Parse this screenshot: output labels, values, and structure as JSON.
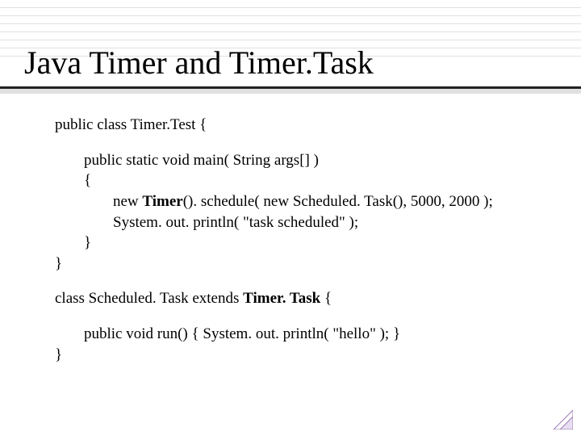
{
  "title": "Java Timer and Timer.Task",
  "code": {
    "class_decl": "public class Timer.Test {",
    "main_sig": "public static void main( String args[] )",
    "open_brace": "{",
    "line_new_prefix": "new ",
    "line_new_bold": "Timer",
    "line_new_suffix": "(). schedule( new Scheduled. Task(), 5000, 2000 );",
    "line_println": "System. out. println( \"task scheduled\" );",
    "close_brace_inner": "}",
    "close_brace_class": "}",
    "sched_prefix": "class Scheduled. Task extends ",
    "sched_bold": "Timer. Task",
    "sched_suffix": " {",
    "run_line": "public void run() { System. out. println( \"hello\" ); }",
    "close_brace_sched": "}"
  }
}
